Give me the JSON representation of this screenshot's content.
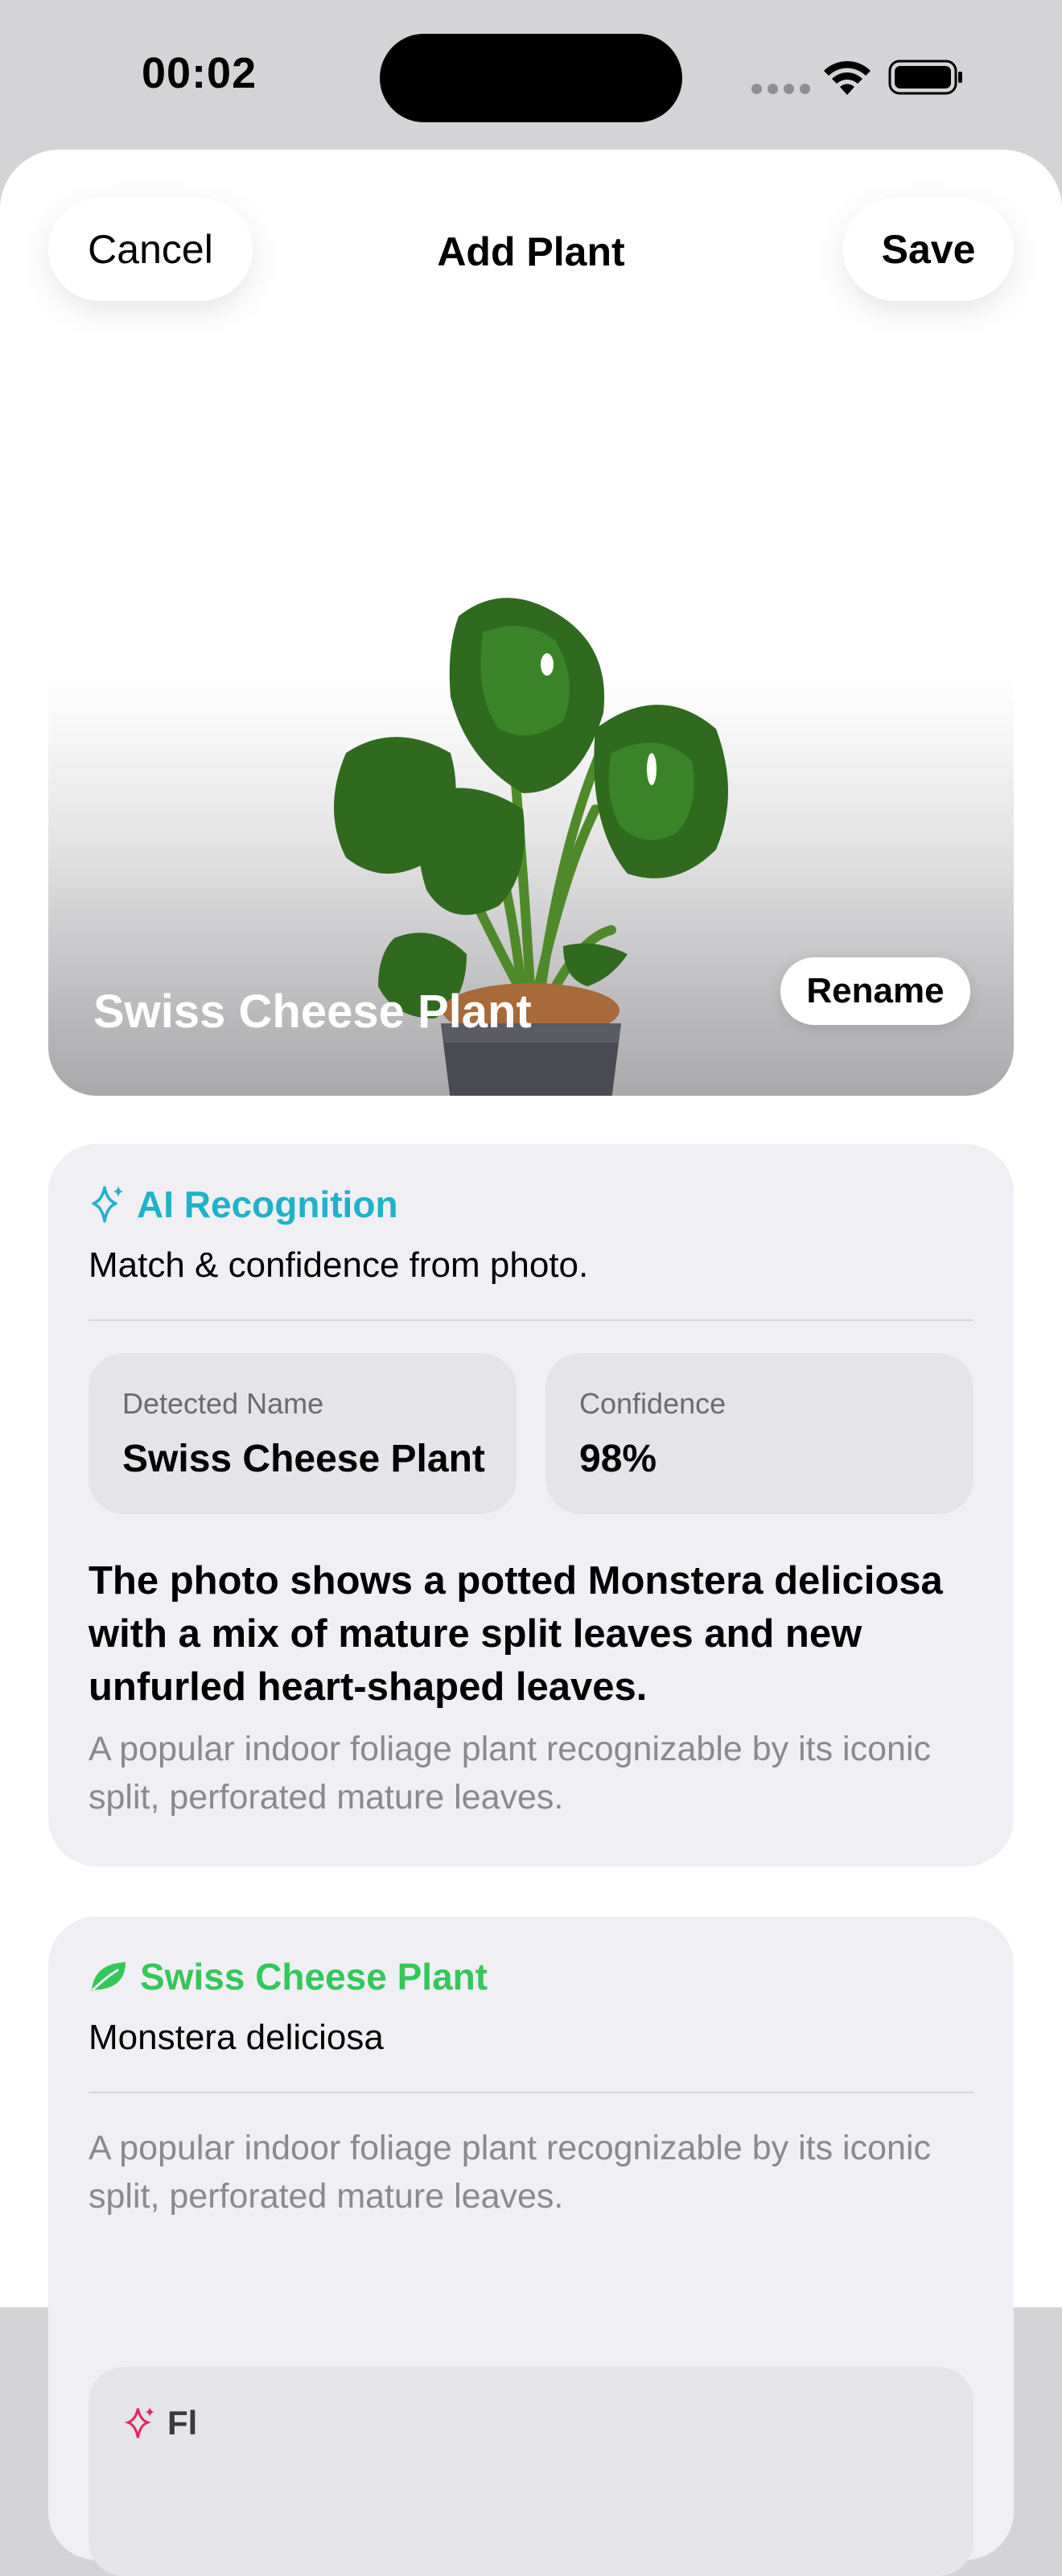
{
  "status_bar": {
    "time": "00:02"
  },
  "nav": {
    "cancel_label": "Cancel",
    "title": "Add Plant",
    "save_label": "Save"
  },
  "hero": {
    "plant_name": "Swiss Cheese Plant",
    "rename_label": "Rename"
  },
  "ai_card": {
    "title": "AI Recognition",
    "subtitle": "Match & confidence from photo.",
    "detected_label": "Detected Name",
    "detected_value": "Swiss Cheese Plant",
    "confidence_label": "Confidence",
    "confidence_value": "98%",
    "description": "The photo shows a potted Monstera deliciosa with a mix of mature split leaves and new unfurled heart-shaped leaves.",
    "summary": "A popular indoor foliage plant recognizable by its iconic split, perforated mature leaves."
  },
  "species_card": {
    "common_name": "Swiss Cheese Plant",
    "scientific_name": "Monstera deliciosa",
    "summary": "A popular indoor foliage plant recognizable by its iconic split, perforated mature leaves.",
    "sub_heading": "Fl"
  },
  "colors": {
    "accent_ai": "#1fb2c9",
    "accent_green": "#34c759",
    "card_bg": "#f0f0f4"
  },
  "icons": {
    "ai": "sparkles-icon",
    "species": "leaf-icon",
    "sub": "sparkles-icon"
  }
}
